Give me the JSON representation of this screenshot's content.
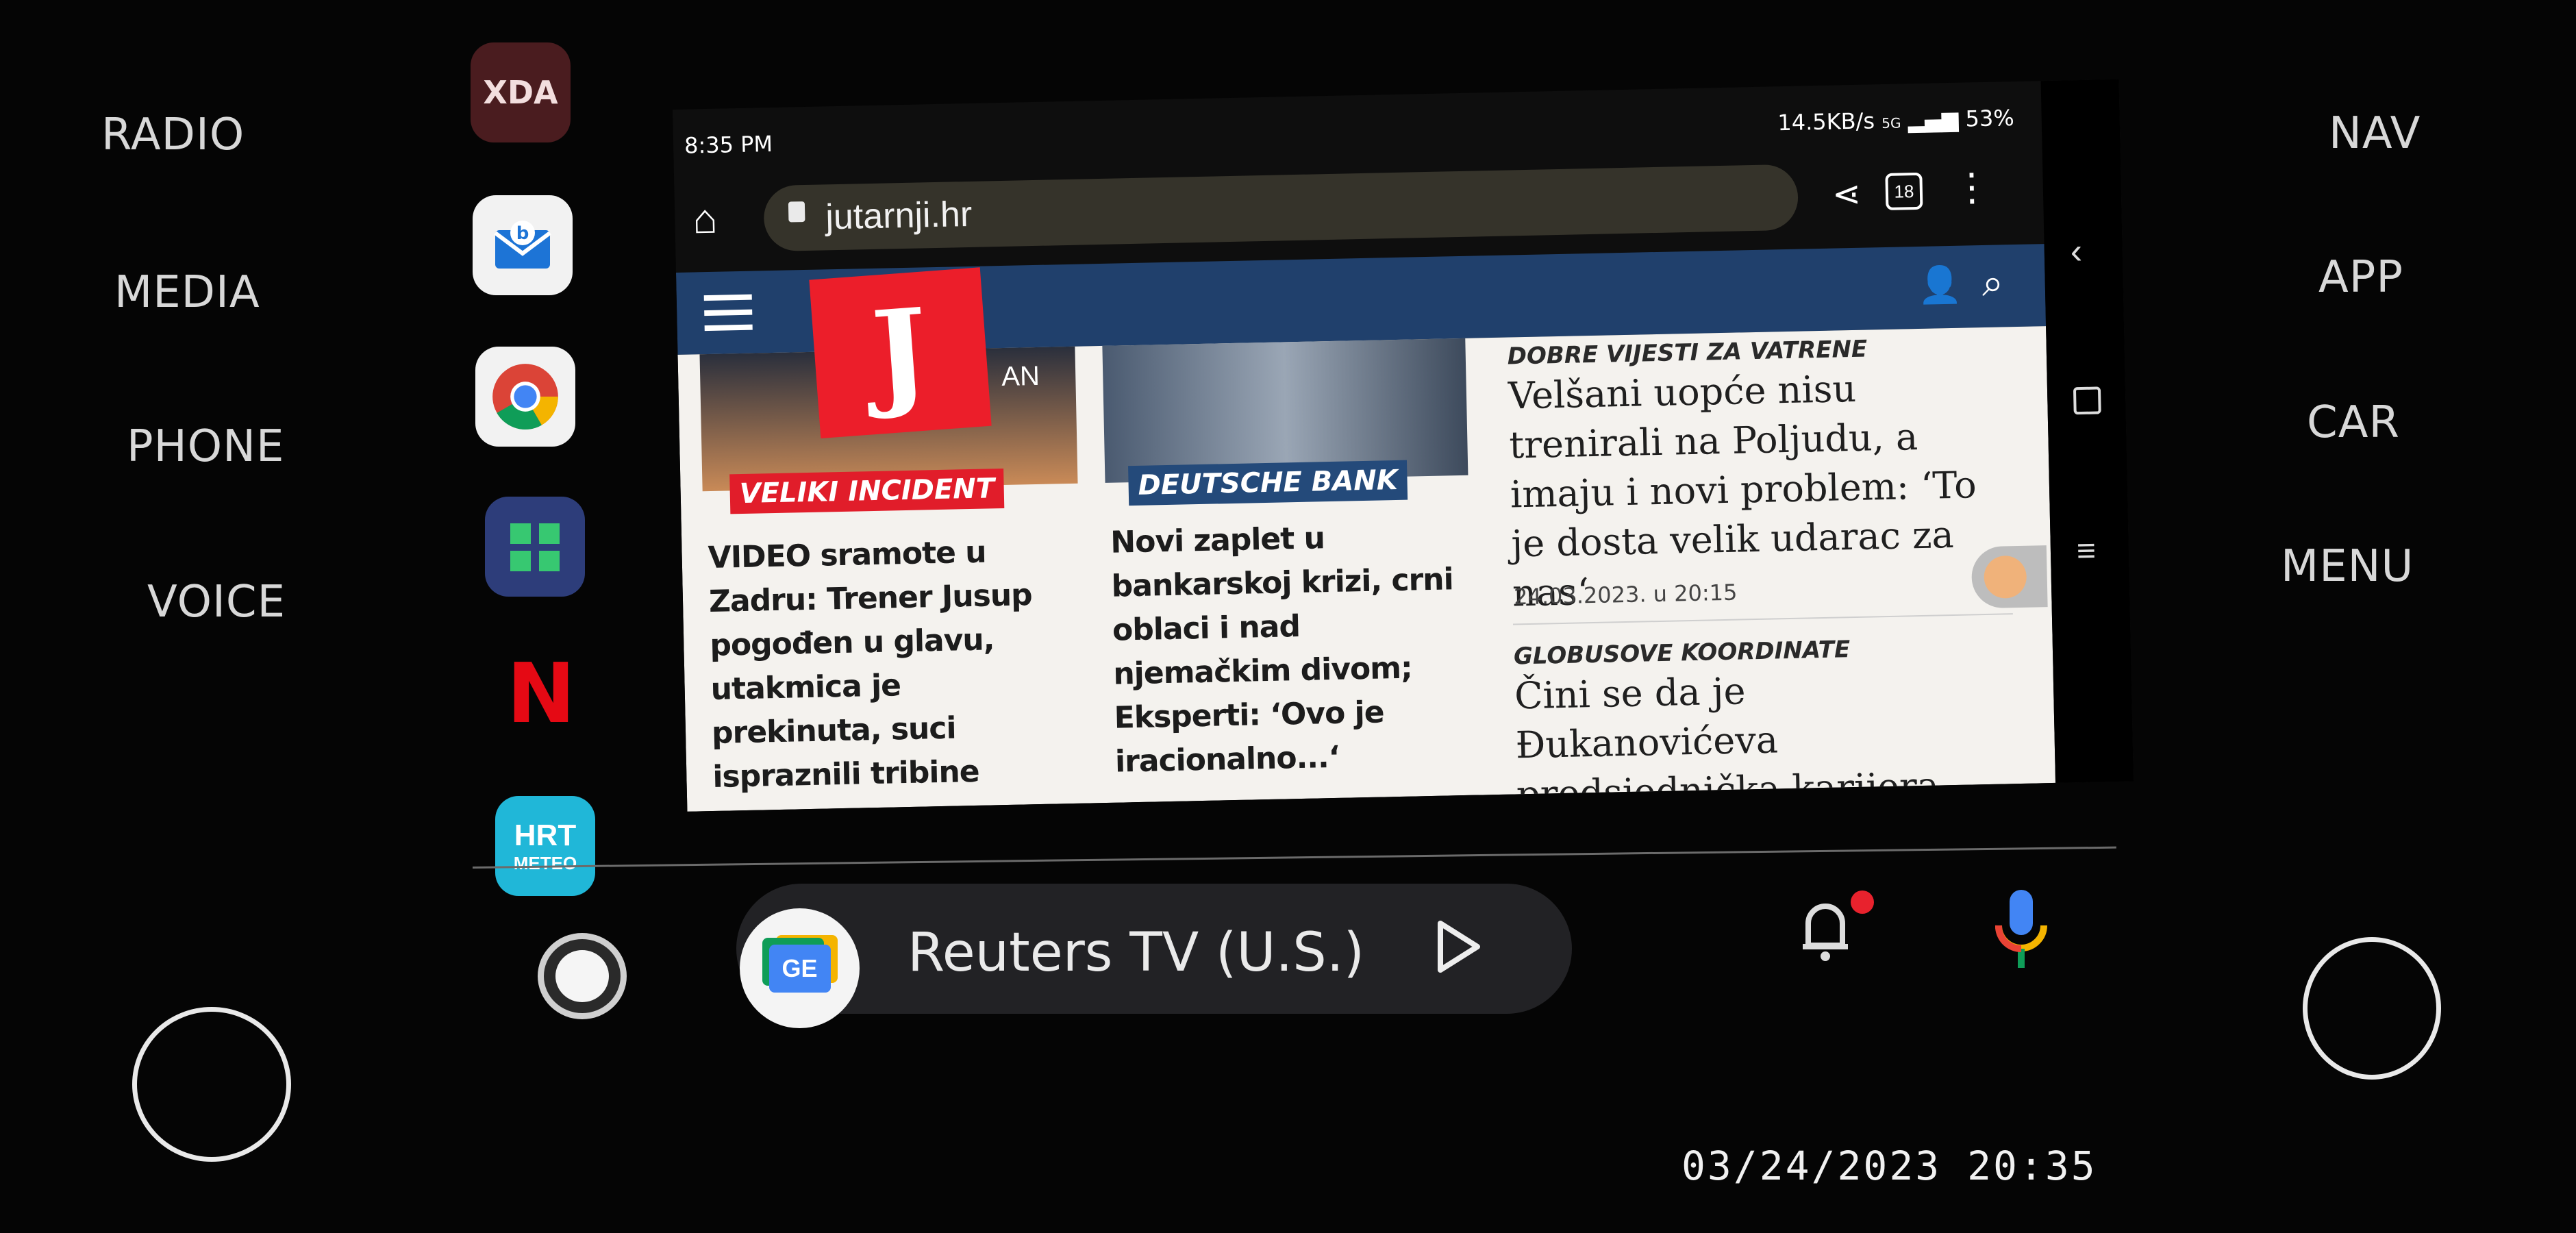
{
  "bezel": {
    "left_labels": [
      "RADIO",
      "MEDIA",
      "PHONE",
      "VOICE"
    ],
    "right_labels": [
      "NAV",
      "APP",
      "CAR",
      "MENU"
    ]
  },
  "dock": {
    "xda_text": "XDA",
    "meteo_text_top": "HRT",
    "meteo_text_bottom": "METEO",
    "netflix_letter": "N"
  },
  "status_bar": {
    "time": "8:35 PM",
    "speed": "14.5KB/s",
    "network": "5G",
    "battery": "53%"
  },
  "browser": {
    "url": "jutarnji.hr",
    "tab_count": "18"
  },
  "site": {
    "logo_letter": "J",
    "articles": [
      {
        "kicker": "VELIKI INCIDENT",
        "headline": "VIDEO sramote u Zadru: Trener Jusup pogođen u glavu, utakmica je prekinuta, suci ispraznili tribine",
        "photo_text": "AN"
      },
      {
        "kicker": "DEUTSCHE BANK",
        "headline": "Novi zaplet u bankarskoj krizi, crni oblaci i nad njemačkim divom; Eksperti: ‘Ovo je iracionalno...‘"
      },
      {
        "category": "DOBRE VIJESTI ZA VATRENE",
        "headline": "Velšani uopće nisu trenirali na Poljudu, a imaju i novi problem: ‘To je dosta velik udarac za nas‘",
        "date": "24.03.2023. u 20:15"
      },
      {
        "category": "GLOBUSOVE KOORDINATE",
        "headline": "Čini se da je Đukanovićeva predsjednička karijera"
      }
    ]
  },
  "bottom_bar": {
    "media_source_icon": "GE",
    "media_title": "Reuters TV (U.S.)"
  },
  "photo_timestamp": "03/24/2023 20:35",
  "colors": {
    "site_nav": "#20406c",
    "logo_red": "#ec1e2a",
    "kicker_blue": "#244a7a",
    "notification_dot": "#e8222d"
  }
}
